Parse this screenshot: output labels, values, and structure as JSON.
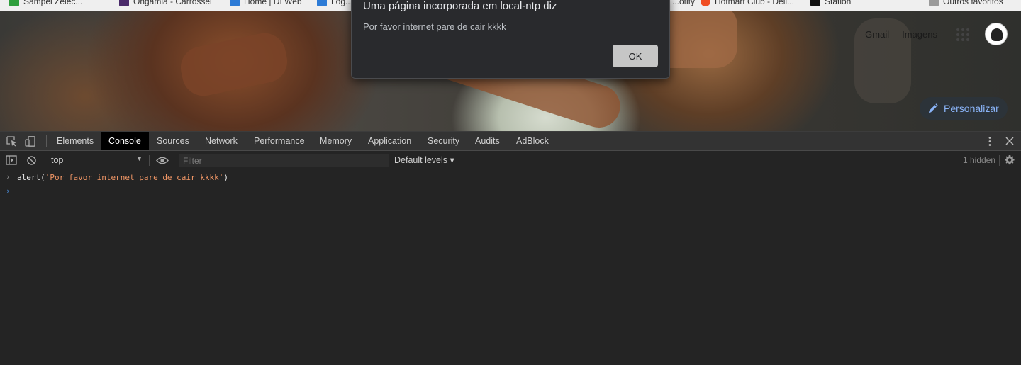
{
  "bookmarks": [
    {
      "label": "Sampel Zelec...",
      "color": "#2e9e3c"
    },
    {
      "label": "Ongamia - Carrossel",
      "color": "#4a2a6a"
    },
    {
      "label": "Home | DI Web",
      "color": "#2d7bd6"
    },
    {
      "label": "Log...",
      "color": "#2d7bd6"
    },
    {
      "label": "...otify",
      "color": "#1db954"
    },
    {
      "label": "Hotmart Club - Dell...",
      "color": "#f04e23"
    },
    {
      "label": "Station",
      "color": "#111111"
    },
    {
      "label": "Outros favoritos",
      "color": "#9a9a9a"
    }
  ],
  "ntp": {
    "gmail_label": "Gmail",
    "images_label": "Imagens",
    "customize_label": "Personalizar"
  },
  "dialog": {
    "title": "Uma página incorporada em local-ntp diz",
    "message": "Por favor internet pare de cair kkkk",
    "ok_label": "OK"
  },
  "devtools": {
    "tabs": [
      {
        "label": "Elements",
        "active": false
      },
      {
        "label": "Console",
        "active": true
      },
      {
        "label": "Sources",
        "active": false
      },
      {
        "label": "Network",
        "active": false
      },
      {
        "label": "Performance",
        "active": false
      },
      {
        "label": "Memory",
        "active": false
      },
      {
        "label": "Application",
        "active": false
      },
      {
        "label": "Security",
        "active": false
      },
      {
        "label": "Audits",
        "active": false
      },
      {
        "label": "AdBlock",
        "active": false
      }
    ],
    "toolbar": {
      "context": "top",
      "filter_placeholder": "Filter",
      "levels_label": "Default levels ▾",
      "hidden_count": "1 hidden"
    },
    "console": {
      "entry_prefix": "alert(",
      "entry_string": "'Por favor internet pare de cair kkkk'",
      "entry_suffix": ")",
      "prompt_symbol": "›"
    }
  },
  "icons": {
    "inspect": "inspect-element-icon",
    "device": "device-toolbar-icon",
    "sidebar": "console-sidebar-icon",
    "clear": "clear-console-icon",
    "eye": "live-expression-eye-icon",
    "settings": "gear-icon",
    "menu": "kebab-menu-icon",
    "close": "close-icon",
    "edit": "pencil-icon",
    "apps": "apps-grid-icon"
  },
  "colors": {
    "accent_blue": "#8ab4f8",
    "string_orange": "#f29766",
    "devtools_bg": "#242424",
    "tabbar_bg": "#333333"
  }
}
